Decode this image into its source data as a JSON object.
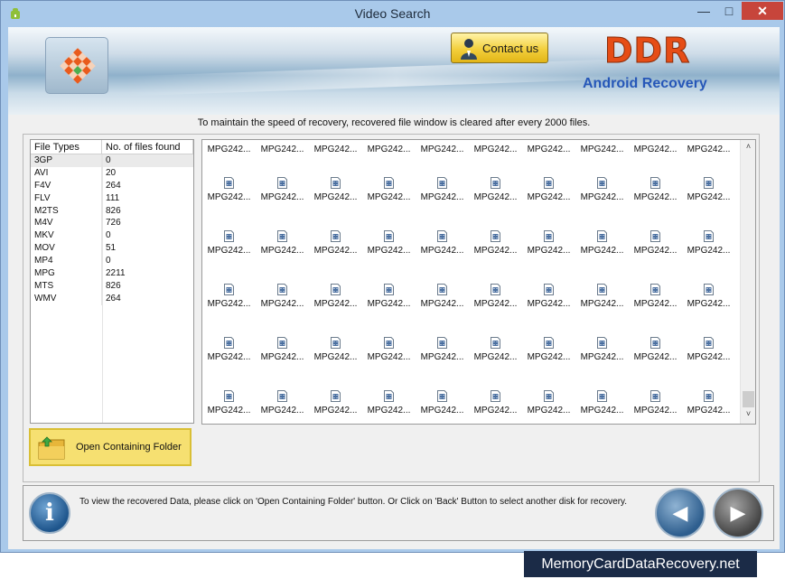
{
  "window": {
    "title": "Video Search",
    "minimize_glyph": "—",
    "maximize_glyph": "□",
    "close_glyph": "✕"
  },
  "banner": {
    "contact_label": "Contact us",
    "brand_name": "DDR",
    "brand_subtitle": "Android Recovery",
    "brand_color": "#e64d16",
    "subtitle_color": "#2657b8"
  },
  "notice": "To maintain the speed of recovery, recovered file window is cleared after every 2000 files.",
  "file_types": {
    "columns": [
      "File Types",
      "No. of files found"
    ],
    "rows": [
      [
        "3GP",
        "0"
      ],
      [
        "AVI",
        "20"
      ],
      [
        "F4V",
        "264"
      ],
      [
        "FLV",
        "111"
      ],
      [
        "M2TS",
        "826"
      ],
      [
        "M4V",
        "726"
      ],
      [
        "MKV",
        "0"
      ],
      [
        "MOV",
        "51"
      ],
      [
        "MP4",
        "0"
      ],
      [
        "MPG",
        "2211"
      ],
      [
        "MTS",
        "826"
      ],
      [
        "WMV",
        "264"
      ]
    ],
    "selected_row": 0
  },
  "open_folder_label": "Open Containing Folder",
  "file_grid": {
    "file_name": "MPG242...",
    "columns": 10,
    "rows": 6,
    "first_row_icons_hidden": true,
    "icon": "video-file-icon"
  },
  "help_text": "To view the recovered Data, please click on 'Open Containing Folder' button. Or Click on 'Back' Button to select another disk for recovery.",
  "nav": {
    "back_glyph": "◀",
    "next_glyph": "▶"
  },
  "info_glyph": "i",
  "scroll": {
    "up": "˄",
    "down": "˅"
  },
  "watermark": "MemoryCardDataRecovery.net"
}
